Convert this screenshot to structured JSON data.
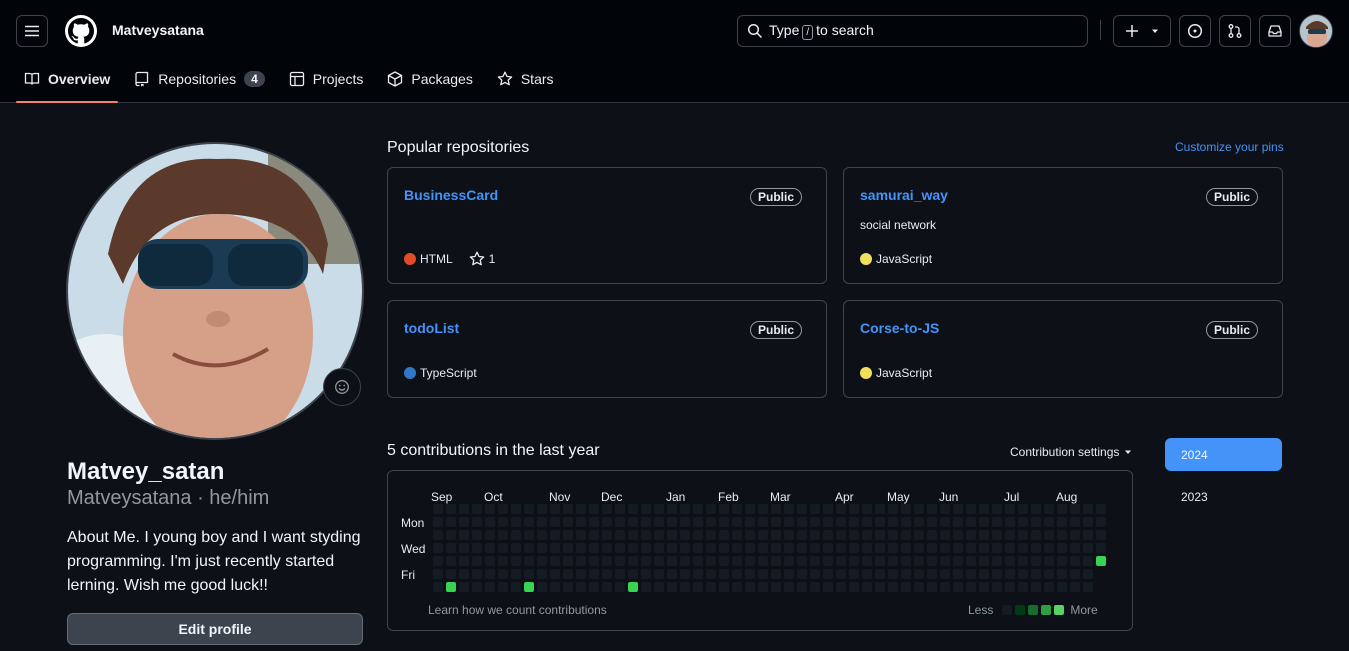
{
  "header": {
    "username": "Matveysatana",
    "search_prefix": "Type",
    "search_key": "/",
    "search_suffix": "to search"
  },
  "tabs": [
    {
      "label": "Overview",
      "icon": "book-icon"
    },
    {
      "label": "Repositories",
      "icon": "repo-icon",
      "count": "4"
    },
    {
      "label": "Projects",
      "icon": "table-icon"
    },
    {
      "label": "Packages",
      "icon": "package-icon"
    },
    {
      "label": "Stars",
      "icon": "star-icon"
    }
  ],
  "profile": {
    "name": "Matvey_satan",
    "login": "Matveysatana",
    "pronouns": "he/him",
    "bio": "About Me. I young boy and I want styding programming. I'm just recently started lerning. Wish me good luck!!",
    "edit_label": "Edit profile"
  },
  "popular": {
    "title": "Popular repositories",
    "customize_label": "Customize your pins",
    "repos": [
      {
        "name": "BusinessCard",
        "visibility": "Public",
        "description": "",
        "language": "HTML",
        "language_color": "#e34c26",
        "stars": "1"
      },
      {
        "name": "samurai_way",
        "visibility": "Public",
        "description": "social network",
        "language": "JavaScript",
        "language_color": "#f1e05a"
      },
      {
        "name": "todoList",
        "visibility": "Public",
        "description": "",
        "language": "TypeScript",
        "language_color": "#3178c6"
      },
      {
        "name": "Corse-to-JS",
        "visibility": "Public",
        "description": "",
        "language": "JavaScript",
        "language_color": "#f1e05a"
      }
    ]
  },
  "contributions": {
    "title": "5 contributions in the last year",
    "settings_label": "Contribution settings",
    "months": [
      "Sep",
      "Oct",
      "Nov",
      "Dec",
      "Jan",
      "Feb",
      "Mar",
      "Apr",
      "May",
      "Jun",
      "Jul",
      "Aug"
    ],
    "days": [
      "Mon",
      "Wed",
      "Fri"
    ],
    "learn_label": "Learn how we count contributions",
    "less_label": "Less",
    "more_label": "More",
    "levels": [
      "#151b23",
      "#033a16",
      "#196c2e",
      "#2ea043",
      "#56d364"
    ],
    "active_color": "#39d353"
  },
  "years": [
    "2024",
    "2023"
  ]
}
